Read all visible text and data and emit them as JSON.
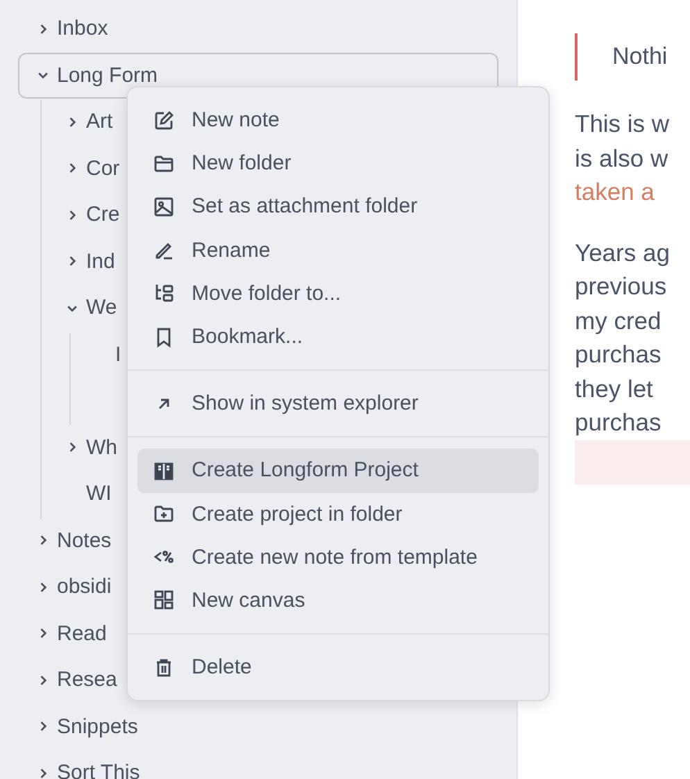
{
  "sidebar": {
    "tree": [
      {
        "label": "Inbox",
        "kind": "folder",
        "expanded": false,
        "selected": false
      },
      {
        "label": "Long Form",
        "kind": "folder",
        "expanded": true,
        "selected": true,
        "children": [
          {
            "label": "Art",
            "kind": "folder",
            "expanded": false,
            "selected": false
          },
          {
            "label": "Cor",
            "kind": "folder",
            "expanded": false,
            "selected": false
          },
          {
            "label": "Cre",
            "kind": "folder",
            "expanded": false,
            "selected": false
          },
          {
            "label": "Ind",
            "kind": "folder",
            "expanded": false,
            "selected": false
          },
          {
            "label": "We",
            "kind": "folder",
            "expanded": true,
            "selected": false,
            "children": [
              {
                "label": "I",
                "kind": "file",
                "selected": false
              }
            ]
          },
          {
            "label": "Wh",
            "kind": "folder",
            "expanded": false,
            "selected": false
          },
          {
            "label": "WI",
            "kind": "file",
            "selected": false
          }
        ]
      },
      {
        "label": "Notes",
        "kind": "folder",
        "expanded": false,
        "selected": false
      },
      {
        "label": "obsidi",
        "kind": "folder",
        "expanded": false,
        "selected": false
      },
      {
        "label": "Read",
        "kind": "folder",
        "expanded": false,
        "selected": false
      },
      {
        "label": "Resea",
        "kind": "folder",
        "expanded": false,
        "selected": false
      },
      {
        "label": "Snippets",
        "kind": "folder",
        "expanded": false,
        "selected": false
      },
      {
        "label": "Sort This",
        "kind": "folder",
        "expanded": false,
        "selected": false
      }
    ]
  },
  "context_menu": {
    "sections": [
      [
        {
          "label": "New note",
          "selected": false
        },
        {
          "label": "New folder",
          "selected": false
        },
        {
          "label": "Set as attachment folder",
          "selected": false
        },
        {
          "label": "Rename",
          "selected": false
        },
        {
          "label": "Move folder to...",
          "selected": false
        },
        {
          "label": "Bookmark...",
          "selected": false
        }
      ],
      [
        {
          "label": "Show in system explorer",
          "selected": false
        }
      ],
      [
        {
          "label": "Create Longform Project",
          "selected": true
        },
        {
          "label": "Create project in folder",
          "selected": false
        },
        {
          "label": "Create new note from template",
          "selected": false
        },
        {
          "label": "New canvas",
          "selected": false
        }
      ],
      [
        {
          "label": "Delete",
          "selected": false
        }
      ]
    ]
  },
  "editor": {
    "quote": "Nothi",
    "paragraphs": [
      {
        "lines": [
          {
            "text": "This is w",
            "kind": "plain"
          },
          {
            "text": "is also w",
            "kind": "plain"
          },
          {
            "text": "taken a",
            "kind": "link"
          }
        ]
      },
      {
        "lines": [
          {
            "text": "Years ag",
            "kind": "plain"
          },
          {
            "text": "previous",
            "kind": "plain"
          },
          {
            "text": "my cred",
            "kind": "plain"
          },
          {
            "text": "purchas",
            "kind": "plain"
          },
          {
            "text": "they let",
            "kind": "plain"
          },
          {
            "text": "purchas",
            "kind": "plain"
          }
        ]
      }
    ]
  }
}
